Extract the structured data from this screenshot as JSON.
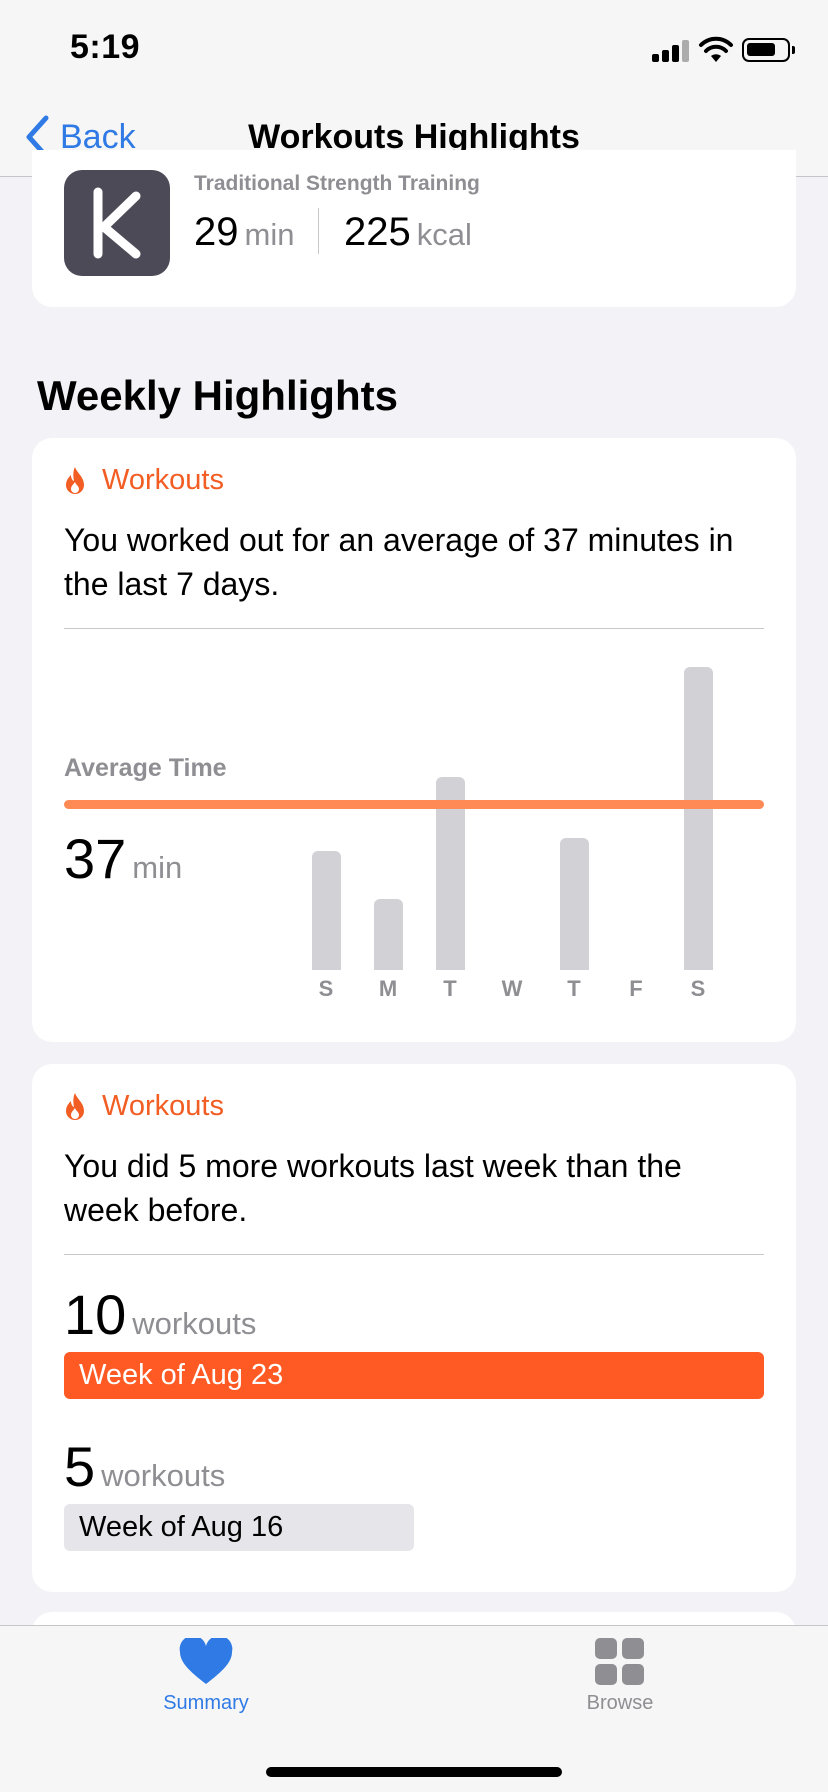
{
  "status_bar": {
    "time": "5:19",
    "icons": [
      "cellular-signal-icon",
      "wifi-icon",
      "battery-icon"
    ]
  },
  "nav": {
    "back_label": "Back",
    "title": "Workouts Highlights"
  },
  "recent_workout": {
    "app_icon": "keep-app-icon",
    "type": "Traditional Strength Training",
    "duration_value": "29",
    "duration_unit": "min",
    "energy_value": "225",
    "energy_unit": "kcal"
  },
  "section_title": "Weekly Highlights",
  "highlight_avg": {
    "category": "Workouts",
    "category_icon": "flame-icon",
    "description": "You worked out for an average of 37 minutes in the last 7 days.",
    "average_label": "Average Time",
    "average_value": "37",
    "average_unit": "min"
  },
  "chart_data": {
    "type": "bar",
    "categories": [
      "S",
      "M",
      "T",
      "W",
      "T",
      "F",
      "S"
    ],
    "values": [
      37,
      22,
      60,
      0,
      41,
      0,
      94
    ],
    "reference_line": 37,
    "ylim": [
      0,
      100
    ]
  },
  "highlight_count": {
    "category": "Workouts",
    "category_icon": "flame-icon",
    "description": "You did 5 more workouts last week than the week before.",
    "current": {
      "value": "10",
      "unit": "workouts",
      "week_label": "Week of Aug 23",
      "color": "#ff5a23"
    },
    "previous": {
      "value": "5",
      "unit": "workouts",
      "week_label": "Week of Aug 16",
      "color": "#e5e5ea"
    }
  },
  "tab_bar": {
    "tabs": [
      {
        "label": "Summary",
        "icon": "heart-icon",
        "selected": true
      },
      {
        "label": "Browse",
        "icon": "grid-icon",
        "selected": false
      }
    ]
  },
  "colors": {
    "accent": "#2f7ae5",
    "workouts": "#f25d23",
    "average_line": "#ff8a55"
  }
}
